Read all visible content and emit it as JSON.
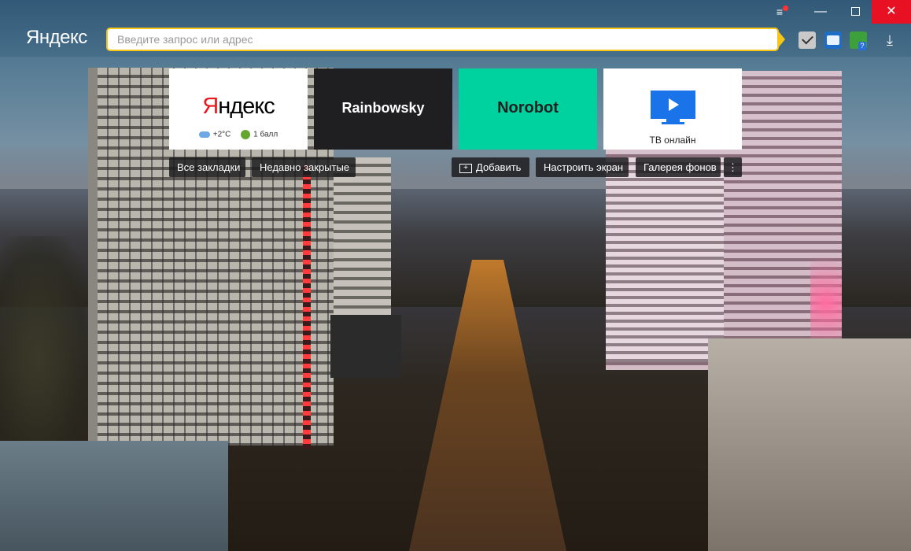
{
  "browser": {
    "logo": "Яндекс",
    "address_placeholder": "Введите запрос или адрес"
  },
  "window_controls": {
    "menu": "≡",
    "minimize": "—",
    "close": "✕"
  },
  "toolbar_icons": [
    "protect-check-icon",
    "extension-icon",
    "puzzle-extension-icon",
    "download-icon"
  ],
  "tiles": [
    {
      "id": "yandex",
      "title": "Яндекс",
      "title_first": "Я",
      "title_rest": "ндекс",
      "weather": "+2°C",
      "traffic": "1 балл"
    },
    {
      "id": "rainbowsky",
      "title": "Rainbowsky"
    },
    {
      "id": "norobot",
      "title": "Norobot"
    },
    {
      "id": "tv",
      "title": "ТВ онлайн"
    }
  ],
  "actions": {
    "all_bookmarks": "Все закладки",
    "recently_closed": "Недавно закрытые",
    "add": "Добавить",
    "customize": "Настроить экран",
    "gallery": "Галерея фонов",
    "more": "⋮"
  },
  "colors": {
    "accent": "#f5c518",
    "yandex_red": "#e8181e",
    "norobot_tile": "#00d29f",
    "rainbowsky_tile": "#1f1f22",
    "close_button": "#e81123"
  }
}
